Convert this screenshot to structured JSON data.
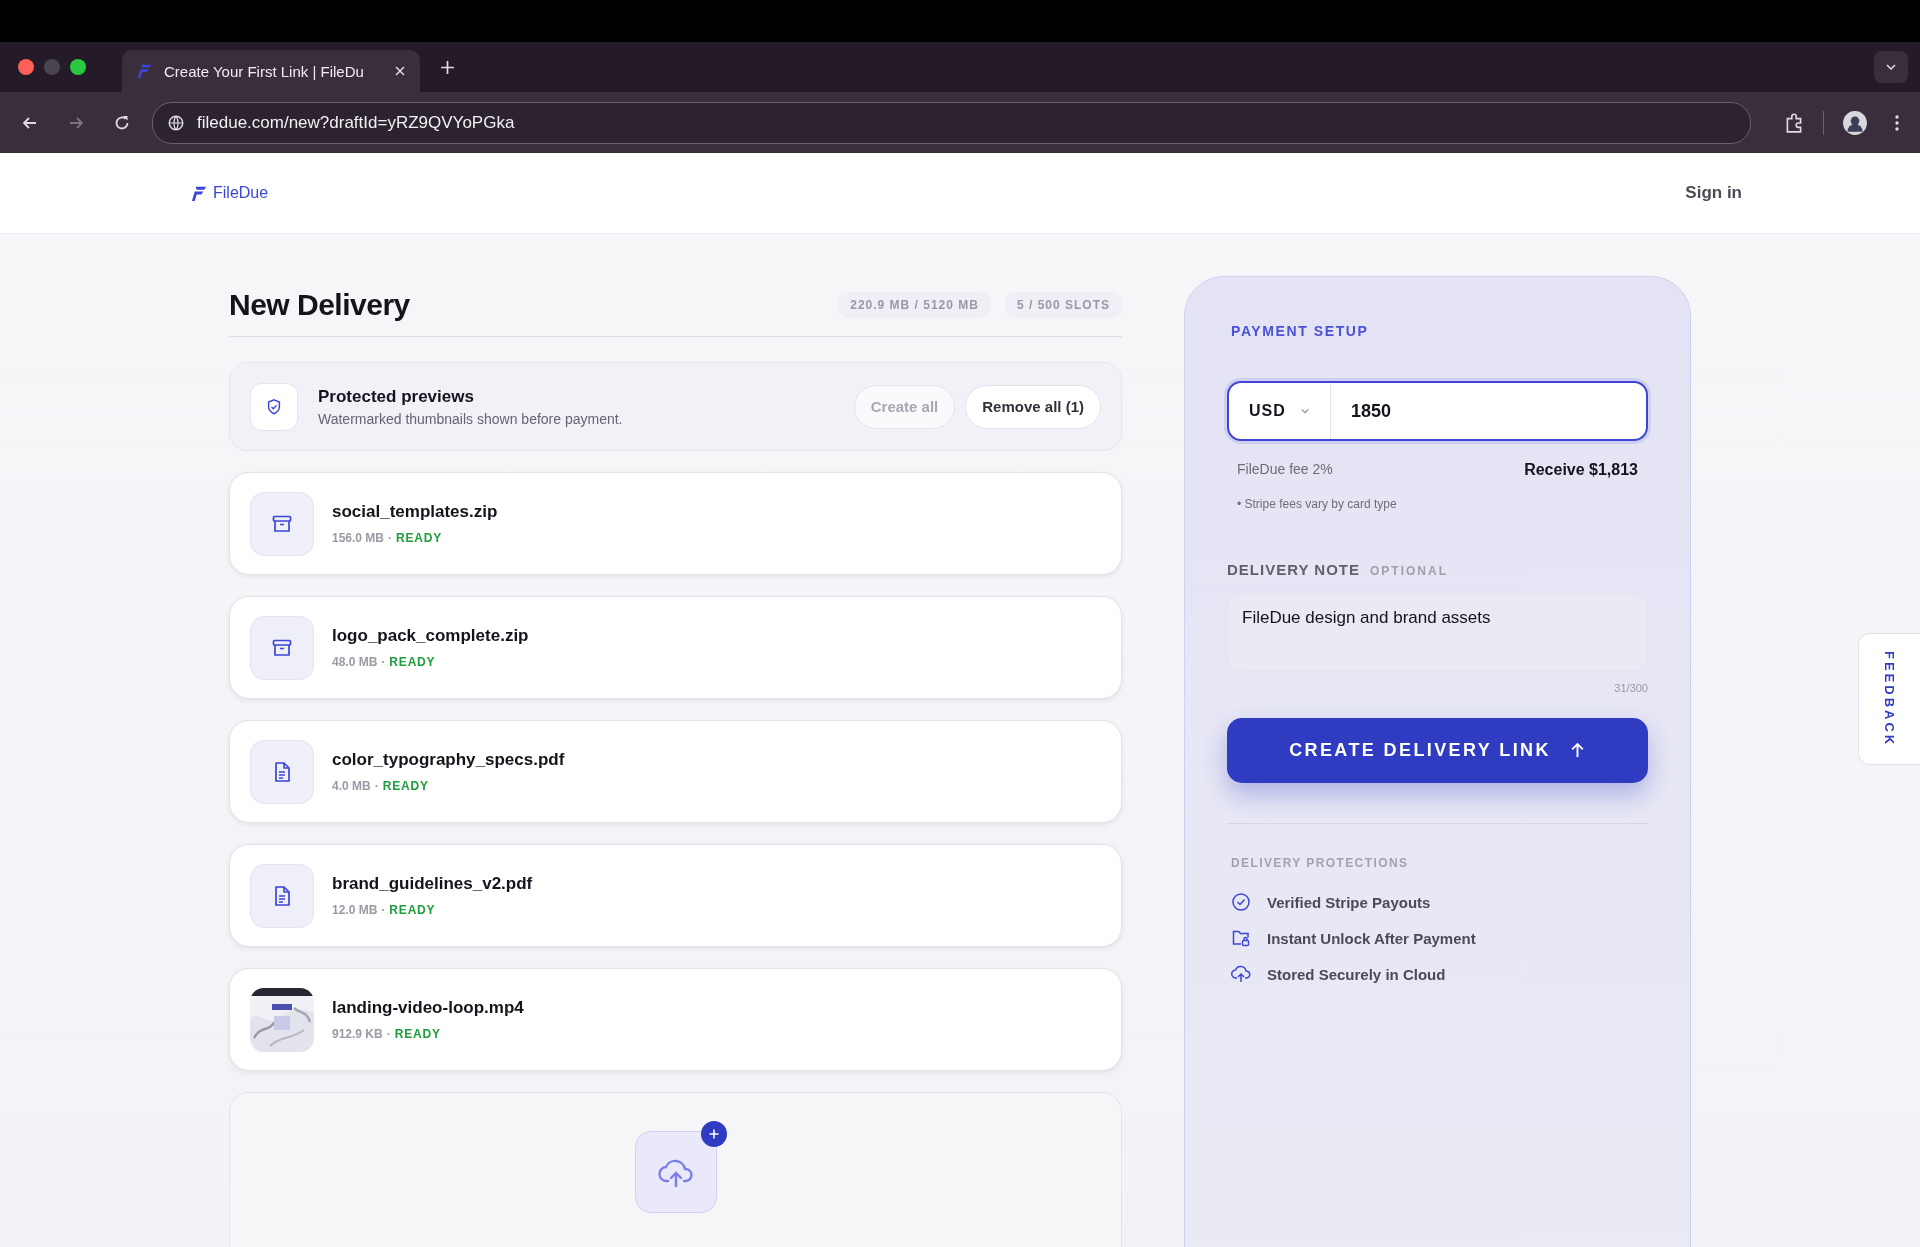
{
  "browser": {
    "tab_title": "Create Your First Link | FileDu",
    "url": "filedue.com/new?draftId=yRZ9QVYoPGka",
    "forward_disabled": true
  },
  "header": {
    "logo": "FileDue",
    "sign_in": "Sign in"
  },
  "delivery": {
    "title": "New Delivery",
    "storage": "220.9 MB / 5120 MB",
    "slots": "5 / 500 SLOTS",
    "previews": {
      "title": "Protected previews",
      "subtitle": "Watermarked thumbnails shown before payment.",
      "actions": [
        {
          "label": "Create all",
          "disabled": true
        },
        {
          "label": "Remove all (1)",
          "disabled": false
        }
      ]
    },
    "files": [
      {
        "kind": "archive",
        "name": "social_templates.zip",
        "size": "156.0 MB",
        "separator": "·",
        "status": "READY"
      },
      {
        "kind": "archive",
        "name": "logo_pack_complete.zip",
        "size": "48.0 MB",
        "separator": "·",
        "status": "READY"
      },
      {
        "kind": "document",
        "name": "color_typography_specs.pdf",
        "size": "4.0 MB",
        "separator": "·",
        "status": "READY"
      },
      {
        "kind": "document",
        "name": "brand_guidelines_v2.pdf",
        "size": "12.0 MB",
        "separator": "·",
        "status": "READY"
      },
      {
        "kind": "video",
        "name": "landing-video-loop.mp4",
        "size": "912.9 KB",
        "separator": "·",
        "status": "READY"
      }
    ]
  },
  "payment": {
    "heading": "PAYMENT SETUP",
    "currency": "USD",
    "amount": "1850",
    "fee": "FileDue fee 2%",
    "receive": "Receive $1,813",
    "stripe_note": "• Stripe fees vary by card type",
    "note_label": "DELIVERY NOTE",
    "note_optional": "OPTIONAL",
    "note_value": "FileDue design and brand assets",
    "note_count": "31/300",
    "button": "CREATE DELIVERY LINK",
    "protections_heading": "DELIVERY PROTECTIONS",
    "protections": [
      {
        "kind": "check",
        "text": "Verified Stripe Payouts"
      },
      {
        "kind": "folder-lock",
        "text": "Instant Unlock After Payment"
      },
      {
        "kind": "cloud",
        "text": "Stored Securely in Cloud"
      }
    ]
  },
  "feedback": "FEEDBACK"
}
